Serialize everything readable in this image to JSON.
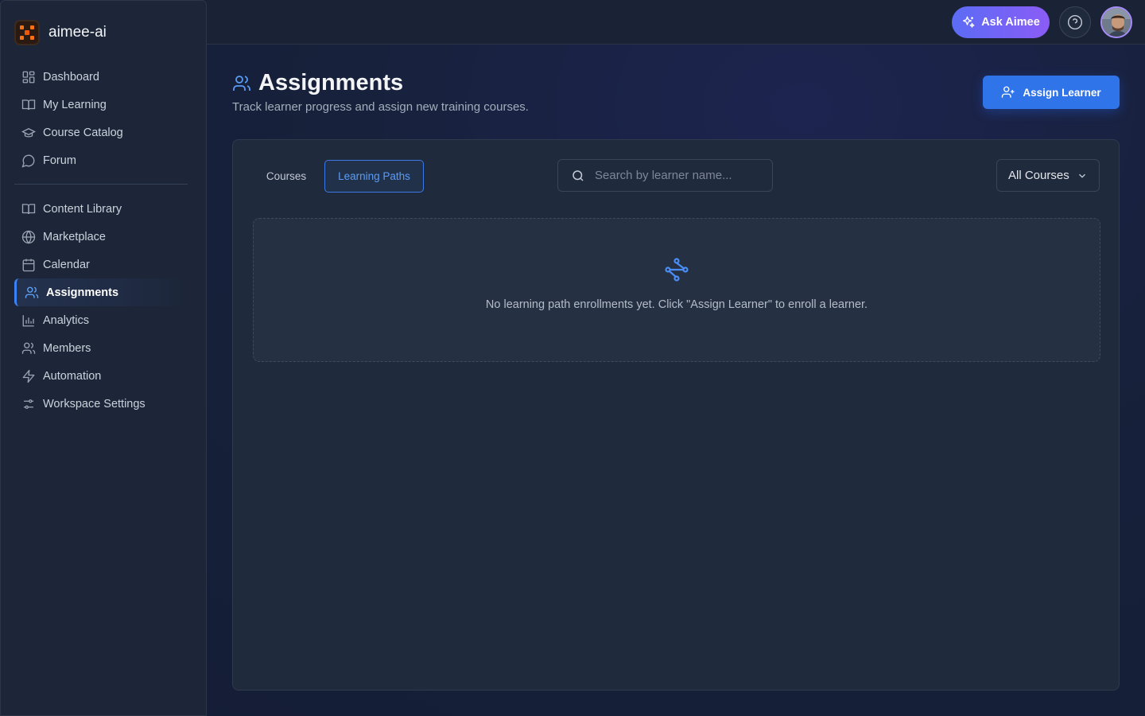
{
  "brand": {
    "name": "aimee-ai"
  },
  "sidebar": {
    "primary": [
      {
        "label": "Dashboard",
        "icon": "dashboard-icon"
      },
      {
        "label": "My Learning",
        "icon": "book-open-icon"
      },
      {
        "label": "Course Catalog",
        "icon": "graduation-cap-icon"
      },
      {
        "label": "Forum",
        "icon": "chat-bubble-icon"
      }
    ],
    "secondary": [
      {
        "label": "Content Library",
        "icon": "book-open-icon"
      },
      {
        "label": "Marketplace",
        "icon": "globe-icon"
      },
      {
        "label": "Calendar",
        "icon": "calendar-icon"
      },
      {
        "label": "Assignments",
        "icon": "users-icon",
        "active": true
      },
      {
        "label": "Analytics",
        "icon": "bar-chart-icon"
      },
      {
        "label": "Members",
        "icon": "users-icon"
      },
      {
        "label": "Automation",
        "icon": "lightning-icon"
      },
      {
        "label": "Workspace Settings",
        "icon": "sliders-icon"
      }
    ]
  },
  "header": {
    "ask_label": "Ask Aimee",
    "help_icon": "help-icon",
    "avatar": "user-avatar"
  },
  "page": {
    "title": "Assignments",
    "subtitle": "Track learner progress and assign new training courses.",
    "assign_label": "Assign Learner"
  },
  "tabs": [
    {
      "label": "Courses",
      "active": false
    },
    {
      "label": "Learning Paths",
      "active": true
    }
  ],
  "search": {
    "placeholder": "Search by learner name...",
    "value": ""
  },
  "filter": {
    "selected": "All Courses"
  },
  "empty_state": {
    "icon": "route-icon",
    "message": "No learning path enrollments yet. Click \"Assign Learner\" to enroll a learner."
  },
  "colors": {
    "accent": "#2f74e8",
    "active_tab": "#3b7ae6",
    "ask_gradient_start": "#5b6cf5",
    "ask_gradient_end": "#8b5cf6"
  }
}
